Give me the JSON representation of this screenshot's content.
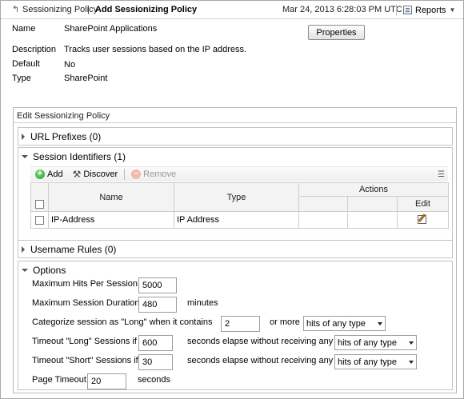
{
  "breadcrumb": {
    "parent": "Sessionizing Policy",
    "separator": "|",
    "current": "Add Sessionizing Policy"
  },
  "header": {
    "timestamp": "Mar 24, 2013 6:28:03 PM UTC",
    "reports_label": "Reports"
  },
  "properties": {
    "button_label": "Properties",
    "rows": [
      {
        "label": "Name",
        "value": "SharePoint Applications"
      },
      {
        "label": "Description",
        "value": "Tracks user sessions based on the IP address."
      },
      {
        "label": "Default",
        "value": "No"
      },
      {
        "label": "Type",
        "value": "SharePoint"
      }
    ]
  },
  "edit_panel": {
    "title": "Edit Sessionizing Policy",
    "url_prefixes": "URL Prefixes (0)",
    "session_identifiers": {
      "title": "Session Identifiers (1)",
      "toolbar": {
        "add": "Add",
        "discover": "Discover",
        "remove": "Remove"
      },
      "columns": {
        "name": "Name",
        "type": "Type",
        "actions": "Actions",
        "edit": "Edit"
      },
      "rows": [
        {
          "name": "IP-Address",
          "type": "IP Address"
        }
      ]
    },
    "username_rules": "Username Rules (0)",
    "options": {
      "title": "Options",
      "max_hits_label": "Maximum Hits Per Session",
      "max_hits_value": "5000",
      "max_duration_label": "Maximum Session Duration",
      "max_duration_value": "480",
      "max_duration_unit": "minutes",
      "long_label": "Categorize session as \"Long\" when it contains",
      "long_value": "2",
      "long_or_more": "or more",
      "long_select": "hits of any type",
      "timeout_long_label": "Timeout \"Long\" Sessions if",
      "timeout_long_value": "600",
      "timeout_long_text": "seconds elapse without receiving any",
      "timeout_long_select": "hits of any type",
      "timeout_short_label": "Timeout \"Short\" Sessions if",
      "timeout_short_value": "30",
      "timeout_short_text": "seconds elapse without receiving any",
      "timeout_short_select": "hits of any type",
      "page_timeout_label": "Page Timeout",
      "page_timeout_value": "20",
      "page_timeout_unit": "seconds"
    }
  }
}
